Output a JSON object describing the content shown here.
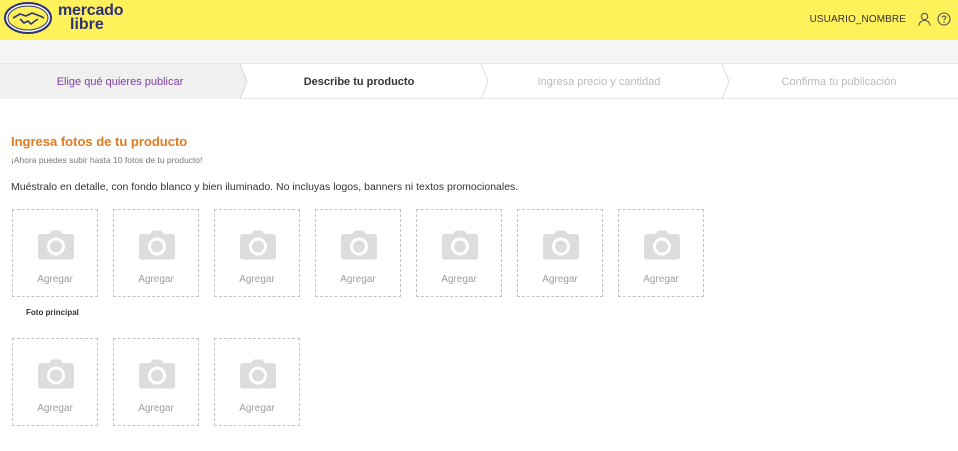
{
  "header": {
    "brand_line1": "mercado",
    "brand_line2": "libre",
    "username": "USUARIO_NOMBRE",
    "user_icon": "user-icon",
    "help_icon": "help-icon",
    "background": "#fff159",
    "brand_color": "#2d3277"
  },
  "steps": [
    {
      "label": "Elige qué quieres publicar",
      "state": "completed"
    },
    {
      "label": "Describe tu producto",
      "state": "current"
    },
    {
      "label": "Ingresa precio y cantidad",
      "state": "pending"
    },
    {
      "label": "Confirma tu publicación",
      "state": "pending"
    }
  ],
  "photos": {
    "title": "Ingresa fotos de tu producto",
    "subtitle": "¡Ahora puedes subir hasta 10 fotos de tu producto!",
    "instructions": "Muéstralo en detalle, con fondo blanco y bien iluminado. No incluyas logos, banners ni textos promocionales.",
    "main_photo_label": "Foto principal",
    "slot_icon": "camera-icon",
    "slots": [
      {
        "label": "Agregar"
      },
      {
        "label": "Agregar"
      },
      {
        "label": "Agregar"
      },
      {
        "label": "Agregar"
      },
      {
        "label": "Agregar"
      },
      {
        "label": "Agregar"
      },
      {
        "label": "Agregar"
      },
      {
        "label": "Agregar"
      },
      {
        "label": "Agregar"
      },
      {
        "label": "Agregar"
      }
    ],
    "title_color": "#e07b1f"
  }
}
